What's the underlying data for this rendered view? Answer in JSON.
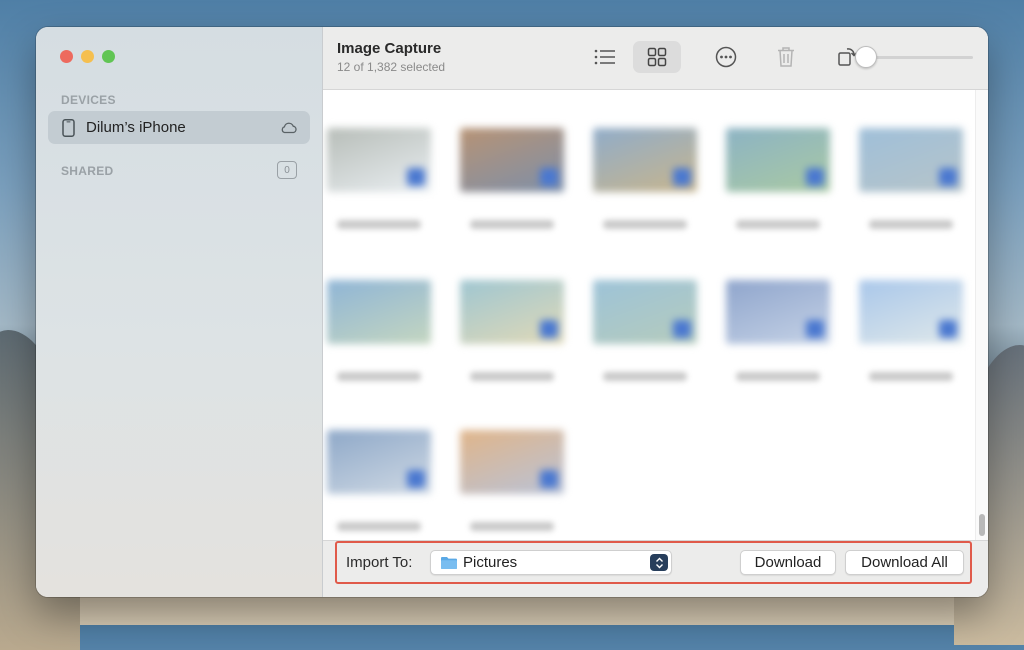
{
  "window": {
    "title": "Image Capture",
    "subtitle": "12 of 1,382 selected"
  },
  "sidebar": {
    "devices_title": "DEVICES",
    "device_name": "Dilum’s iPhone",
    "shared_title": "SHARED",
    "shared_count": "0"
  },
  "toolbar": {
    "buttons": [
      "list-view",
      "grid-view",
      "more",
      "delete",
      "rotate",
      "thumbnail-size"
    ],
    "active_view": "grid-view",
    "thumbnail_size": 0
  },
  "grid": {
    "thumbnails": [
      {
        "colors": [
          "#b7bdb8",
          "#e9eef1"
        ],
        "badge": true
      },
      {
        "colors": [
          "#b79375",
          "#7e8fa8"
        ],
        "badge": true
      },
      {
        "colors": [
          "#90acc9",
          "#c7b58d"
        ],
        "badge": true
      },
      {
        "colors": [
          "#8cb3c4",
          "#a9c9a3"
        ],
        "badge": true
      },
      {
        "colors": [
          "#9fbfd9",
          "#b6c4c9"
        ],
        "badge": true
      },
      {
        "colors": [
          "#8fb5d6",
          "#c4d6c0"
        ],
        "badge": false
      },
      {
        "colors": [
          "#9fc6d1",
          "#e0d9b7"
        ],
        "badge": true
      },
      {
        "colors": [
          "#9dc3d8",
          "#b5cbbc"
        ],
        "badge": true
      },
      {
        "colors": [
          "#8fa5cc",
          "#c5d2e6"
        ],
        "badge": true
      },
      {
        "colors": [
          "#a9c7ea",
          "#dfe8ea"
        ],
        "badge": true
      },
      {
        "colors": [
          "#8ea8c8",
          "#cfd9e4"
        ],
        "badge": true
      },
      {
        "colors": [
          "#e0b58a",
          "#b9c2d6"
        ],
        "badge": true
      }
    ]
  },
  "bottom_bar": {
    "import_label": "Import To:",
    "destination": "Pictures",
    "download_label": "Download",
    "download_all_label": "Download All"
  },
  "colors": {
    "accent": "#4a78d0",
    "highlight": "#e05a4a"
  }
}
